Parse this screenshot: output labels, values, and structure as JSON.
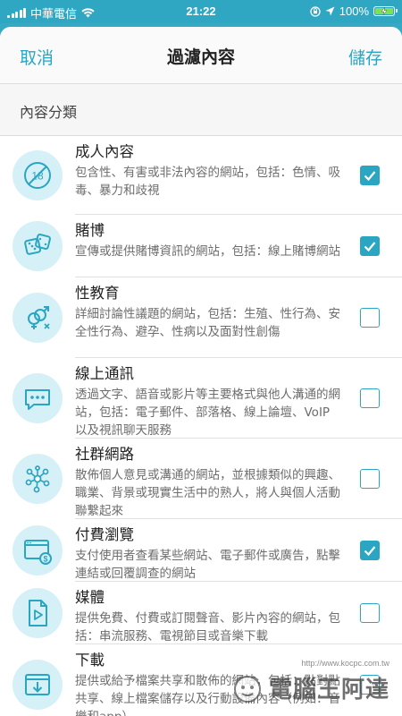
{
  "status_bar": {
    "carrier": "中華電信",
    "time": "21:22",
    "battery": "100%"
  },
  "nav": {
    "cancel": "取消",
    "title": "過濾內容",
    "save": "儲存"
  },
  "section_title": "內容分類",
  "categories": [
    {
      "title": "成人內容",
      "desc": "包含性、有害或非法內容的網站，包括：色情、吸毒、暴力和歧視",
      "checked": true,
      "icon": "age-18-restricted-icon"
    },
    {
      "title": "賭博",
      "desc": "宣傳或提供賭博資訊的網站，包括：線上賭博網站",
      "checked": true,
      "icon": "dice-icon"
    },
    {
      "title": "性教育",
      "desc": "詳細討論性議題的網站，包括：生殖、性行為、安全性行為、避孕、性病以及面對性創傷",
      "checked": false,
      "icon": "gender-symbols-icon"
    },
    {
      "title": "線上通訊",
      "desc": "透過文字、語音或影片等主要格式與他人溝通的網站，包括：電子郵件、部落格、線上論壇、VoIP以及視訊聊天服務",
      "checked": false,
      "icon": "chat-bubble-icon"
    },
    {
      "title": "社群網路",
      "desc": "散佈個人意見或溝通的網站，並根據類似的興趣、職業、背景或現實生活中的熟人，將人與個人活動聯繫起來",
      "checked": false,
      "icon": "network-icon"
    },
    {
      "title": "付費瀏覽",
      "desc": "支付使用者查看某些網站、電子郵件或廣告，點擊連結或回覆調查的網站",
      "checked": true,
      "icon": "paid-browser-icon"
    },
    {
      "title": "媒體",
      "desc": "提供免費、付費或訂閱聲音、影片內容的網站，包括：串流服務、電視節目或音樂下載",
      "checked": false,
      "icon": "media-file-icon"
    },
    {
      "title": "下載",
      "desc": "提供或給予檔案共享和散佈的網站，包括：點對點共享、線上檔案儲存以及行動設備內容（例如：音樂和app）",
      "checked": false,
      "icon": "download-icon"
    }
  ],
  "watermark": {
    "text": "電腦王阿達",
    "url": "http://www.kocpc.com.tw"
  },
  "colors": {
    "accent": "#2aa6c2",
    "icon_bg": "#d6f0f7",
    "status_bar": "#2fa7c2"
  }
}
